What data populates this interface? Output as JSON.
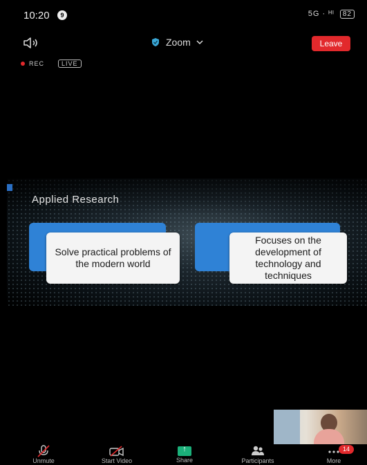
{
  "status_bar": {
    "time": "10:20",
    "notification_count": "9",
    "signal_text": "5G · ᴴᴵ",
    "battery": "82"
  },
  "top_bar": {
    "title": "Zoom",
    "leave_label": "Leave"
  },
  "recording": {
    "rec_label": "REC",
    "live_label": "LIVE"
  },
  "slide": {
    "title": "Applied Research",
    "card_left": "Solve practical problems of the modern world",
    "card_right": "Focuses on the development of technology and techniques"
  },
  "toolbar": {
    "unmute": "Unmute",
    "start_video": "Start Video",
    "share": "Share",
    "participants": "Participants",
    "more": "More",
    "more_badge": "14"
  },
  "colors": {
    "leave": "#e2292c",
    "share_green": "#1bb07a",
    "card_accent": "#2f82d6",
    "shield": "#3aa7d6"
  }
}
